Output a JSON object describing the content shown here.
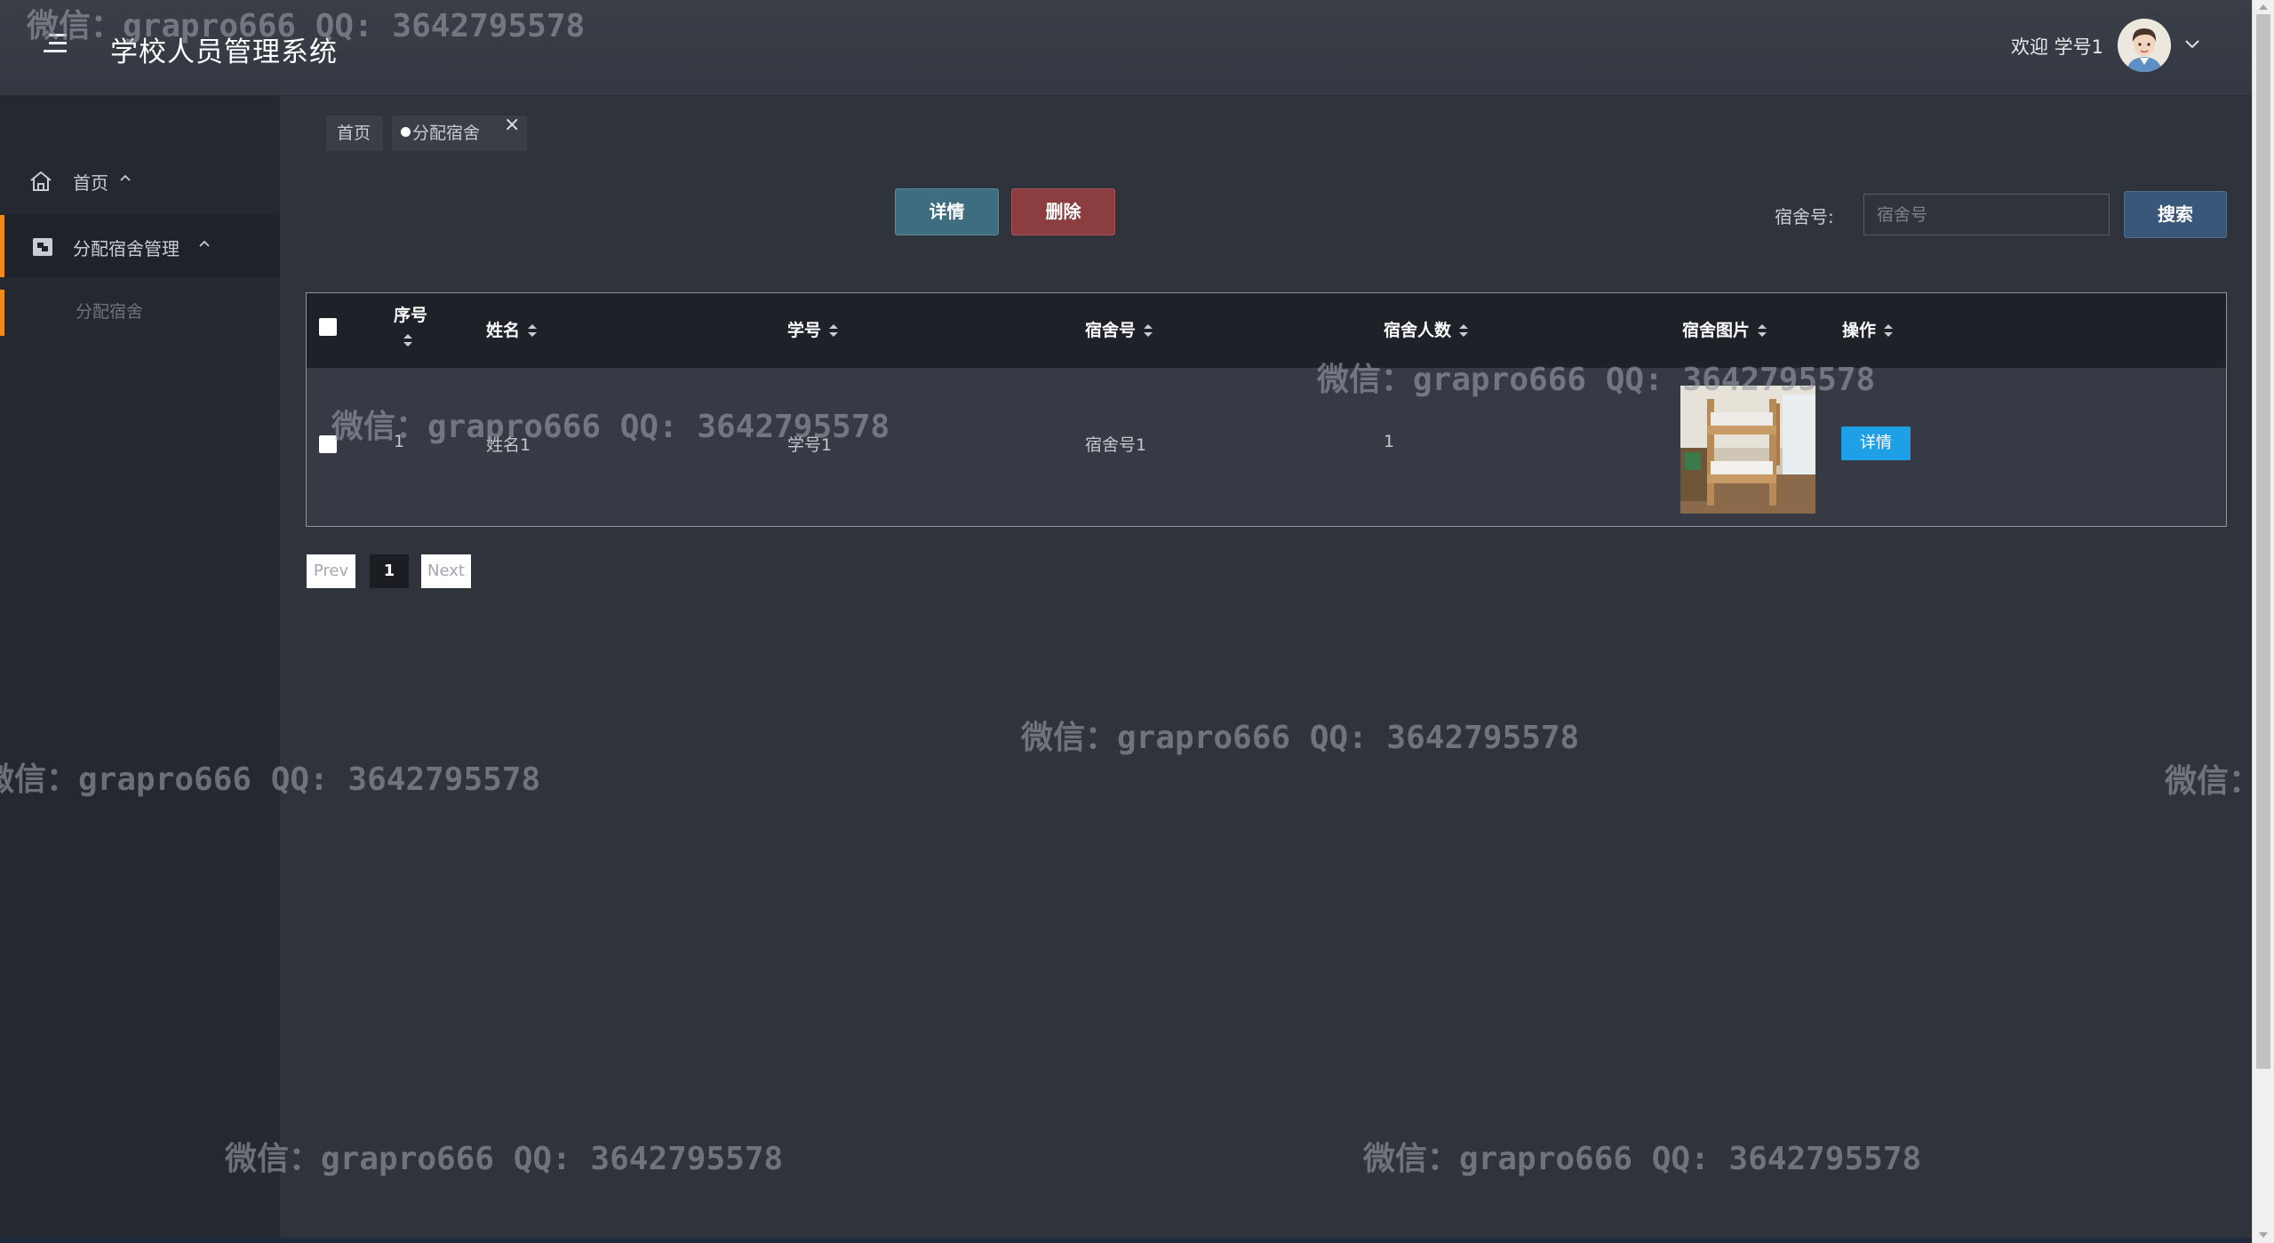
{
  "header": {
    "title": "学校人员管理系统",
    "welcome": "欢迎 学号1"
  },
  "sidebar": {
    "items": [
      {
        "label": "首页",
        "icon": "home-icon"
      },
      {
        "label": "分配宿舍管理",
        "icon": "dorm-icon"
      }
    ],
    "sub_items": [
      {
        "label": "分配宿舍"
      }
    ],
    "accent_color": "#f28a1b"
  },
  "tabs": [
    {
      "label": "首页"
    },
    {
      "label": "分配宿舍"
    }
  ],
  "toolbar": {
    "detail_label": "详情",
    "delete_label": "删除",
    "search_label": "宿舍号:",
    "search_placeholder": "宿舍号",
    "search_button": "搜索"
  },
  "table": {
    "columns": [
      "序号",
      "姓名",
      "学号",
      "宿舍号",
      "宿舍人数",
      "宿舍图片",
      "操作"
    ],
    "rows": [
      {
        "index": "1",
        "name": "姓名1",
        "student_id": "学号1",
        "dorm_no": "宿舍号1",
        "dorm_count": "1",
        "action_label": "详情"
      }
    ]
  },
  "pagination": {
    "prev": "Prev",
    "current": "1",
    "next": "Next"
  },
  "watermark": "微信：grapro666 QQ: 3642795578"
}
